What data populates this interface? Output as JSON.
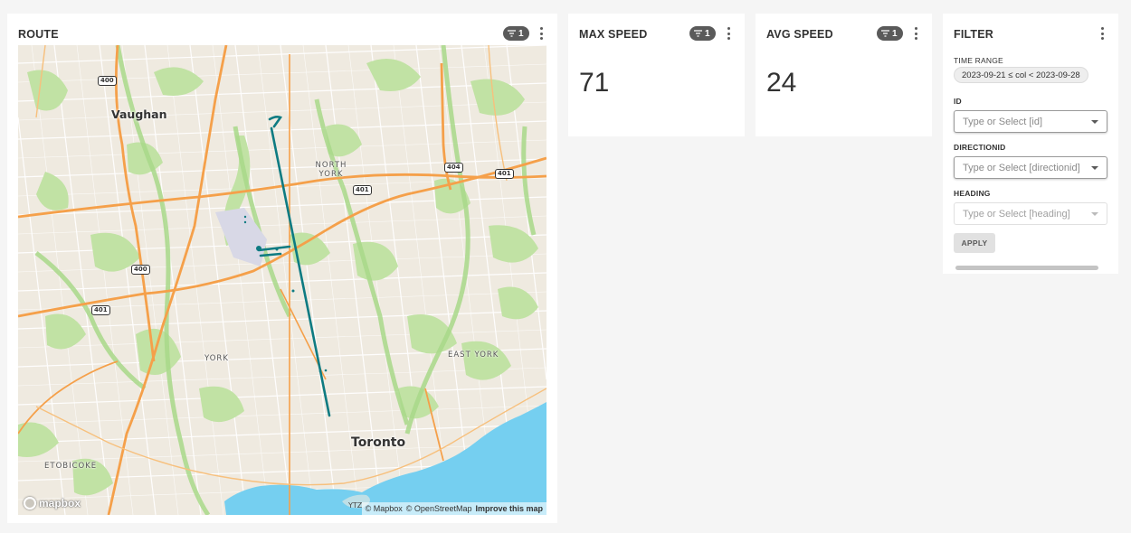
{
  "route_card": {
    "title": "ROUTE",
    "filter_count": "1",
    "map": {
      "places": {
        "vaughan": "Vaughan",
        "north_york": "NORTH YORK",
        "york": "YORK",
        "east_york": "EAST YORK",
        "toronto": "Toronto",
        "etobicoke": "ETOBICOKE",
        "ytz": "YTZ"
      },
      "shields": {
        "s400_top": "400",
        "s400_mid": "400",
        "s401_left": "401",
        "s401_mid": "401",
        "s401_right": "401",
        "s404": "404"
      },
      "logo": "mapbox",
      "attribution": {
        "mapbox": "© Mapbox",
        "osm": "© OpenStreetMap",
        "improve": "Improve this map"
      },
      "route_color": "#0e7b82"
    }
  },
  "max_speed_card": {
    "title": "MAX SPEED",
    "filter_count": "1",
    "value": "71"
  },
  "avg_speed_card": {
    "title": "AVG SPEED",
    "filter_count": "1",
    "value": "24"
  },
  "filter_card": {
    "title": "FILTER",
    "time_range_label": "TIME RANGE",
    "time_range_value": "2023-09-21 ≤ col < 2023-09-28",
    "id_label": "ID",
    "id_placeholder": "Type or Select [id]",
    "directionid_label": "DIRECTIONID",
    "directionid_placeholder": "Type or Select [directionid]",
    "heading_label": "HEADING",
    "heading_placeholder": "Type or Select [heading]",
    "apply_label": "APPLY"
  },
  "colors": {
    "background": "#f5f5f5",
    "card": "#ffffff",
    "badge": "#5a5a5a",
    "water": "#75cff0",
    "highway": "#f5a04a",
    "park": "#c1e2a4"
  }
}
